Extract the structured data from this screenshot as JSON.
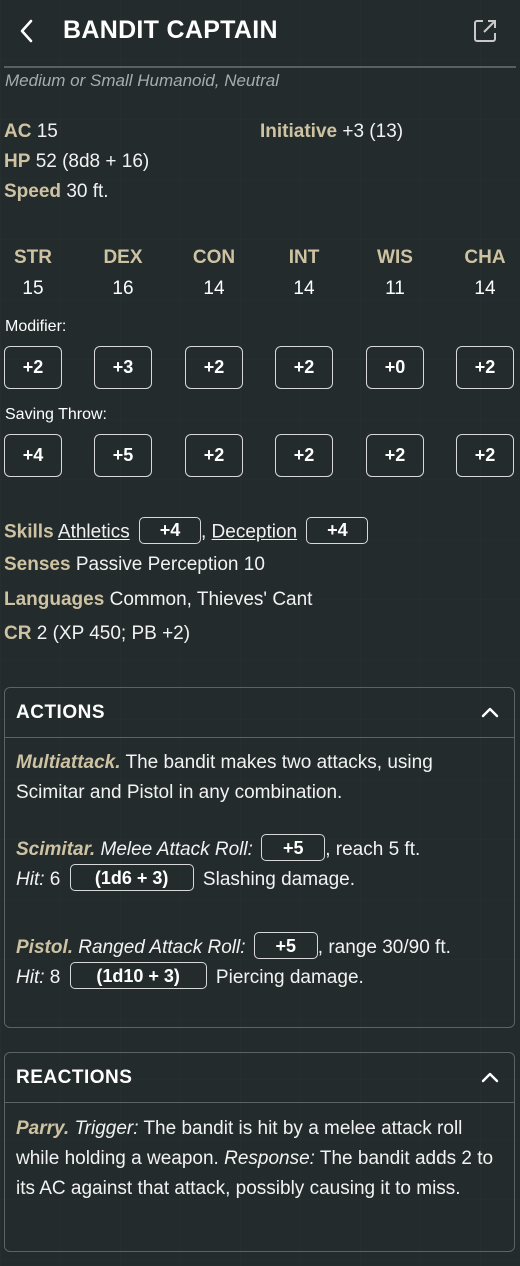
{
  "header": {
    "title": "BANDIT CAPTAIN",
    "back_icon": "chevron-left-icon",
    "external_icon": "external-link-icon"
  },
  "subtitle": "Medium or Small Humanoid, Neutral",
  "stats": {
    "ac_label": "AC",
    "ac_value": "15",
    "hp_label": "HP",
    "hp_value": "52 (8d8 + 16)",
    "speed_label": "Speed",
    "speed_value": "30 ft.",
    "initiative_label": "Initiative",
    "initiative_value": "+3 (13)"
  },
  "abilities": [
    {
      "name": "STR",
      "score": "15",
      "modifier": "+2",
      "save": "+4"
    },
    {
      "name": "DEX",
      "score": "16",
      "modifier": "+3",
      "save": "+5"
    },
    {
      "name": "CON",
      "score": "14",
      "modifier": "+2",
      "save": "+2"
    },
    {
      "name": "INT",
      "score": "14",
      "modifier": "+2",
      "save": "+2"
    },
    {
      "name": "WIS",
      "score": "11",
      "modifier": "+0",
      "save": "+2"
    },
    {
      "name": "CHA",
      "score": "14",
      "modifier": "+2",
      "save": "+2"
    }
  ],
  "labels": {
    "modifier": "Modifier:",
    "saving_throw": "Saving Throw:"
  },
  "skills": {
    "label": "Skills",
    "items": [
      {
        "name": "Athletics",
        "bonus": "+4"
      },
      {
        "name": "Deception",
        "bonus": "+4"
      }
    ],
    "separator": ","
  },
  "senses": {
    "label": "Senses",
    "value": "Passive Perception 10"
  },
  "languages": {
    "label": "Languages",
    "value": "Common, Thieves' Cant"
  },
  "cr": {
    "label": "CR",
    "value": "2 (XP 450; PB +2)"
  },
  "actions": {
    "title": "ACTIONS",
    "multiattack": {
      "name": "Multiattack.",
      "text": "The bandit makes two attacks, using Scimitar and Pistol in any combination."
    },
    "scimitar": {
      "name": "Scimitar.",
      "attack_type": "Melee Attack Roll:",
      "bonus": "+5",
      "reach": ", reach 5 ft.",
      "hit_label": "Hit:",
      "hit_value": "6",
      "dice": "(1d6 + 3)",
      "damage": "Slashing damage."
    },
    "pistol": {
      "name": "Pistol.",
      "attack_type": "Ranged Attack Roll:",
      "bonus": "+5",
      "range": ", range 30/90 ft.",
      "hit_label": "Hit:",
      "hit_value": "8",
      "dice": "(1d10 + 3)",
      "damage": "Piercing damage."
    }
  },
  "reactions": {
    "title": "REACTIONS",
    "parry": {
      "name": "Parry.",
      "trigger_label": "Trigger:",
      "trigger_text": "The bandit is hit by a melee attack roll while holding a weapon.",
      "response_label": "Response:",
      "response_text": "The bandit adds 2 to its AC against that attack, possibly causing it to miss."
    }
  },
  "colors": {
    "background": "#242b2c",
    "accent": "#cdc3a3",
    "border": "#5d6364"
  }
}
